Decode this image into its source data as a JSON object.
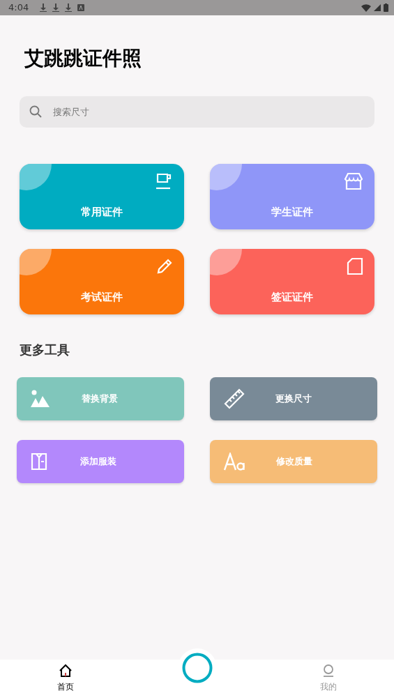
{
  "status_bar": {
    "time": "4:04"
  },
  "title": "艾跳跳证件照",
  "search": {
    "placeholder": "搜索尺寸"
  },
  "categories": [
    {
      "label": "常用证件",
      "color": "#00acc1",
      "kind": "cup"
    },
    {
      "label": "学生证件",
      "color": "#8f96f8",
      "kind": "store"
    },
    {
      "label": "考试证件",
      "color": "#fb760b",
      "kind": "pencil"
    },
    {
      "label": "签证证件",
      "color": "#fc635a",
      "kind": "page"
    }
  ],
  "tools_heading": "更多工具",
  "tools": [
    {
      "label": "替换背景",
      "color": "#80c6bb",
      "kind": "image"
    },
    {
      "label": "更换尺寸",
      "color": "#798a97",
      "kind": "ruler"
    },
    {
      "label": "添加服装",
      "color": "#b388fc",
      "kind": "shirt"
    },
    {
      "label": "修改质量",
      "color": "#f6bc76",
      "kind": "font"
    }
  ],
  "nav": [
    {
      "label": "首页",
      "kind": "home",
      "selected": true
    },
    {
      "label": "我的",
      "kind": "person",
      "selected": false
    }
  ]
}
